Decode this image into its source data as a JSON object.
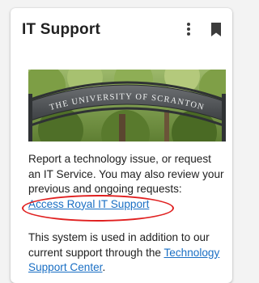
{
  "card": {
    "title": "IT Support",
    "menu_icon": "more-vert-icon",
    "bookmark_icon": "bookmark-icon"
  },
  "banner": {
    "sign_text": "THE UNIVERSITY OF SCRANTON"
  },
  "description": {
    "text": "Report a technology issue, or request an IT Service. You may also review your previous and ongoing requests:",
    "link_label": "Access Royal IT Support"
  },
  "secondary": {
    "text": "This system is used in addition to our current support through the",
    "link_label": "Technology Support Center",
    "trailing": "."
  },
  "colors": {
    "link": "#1a6fc4",
    "annotation": "#e02020"
  }
}
